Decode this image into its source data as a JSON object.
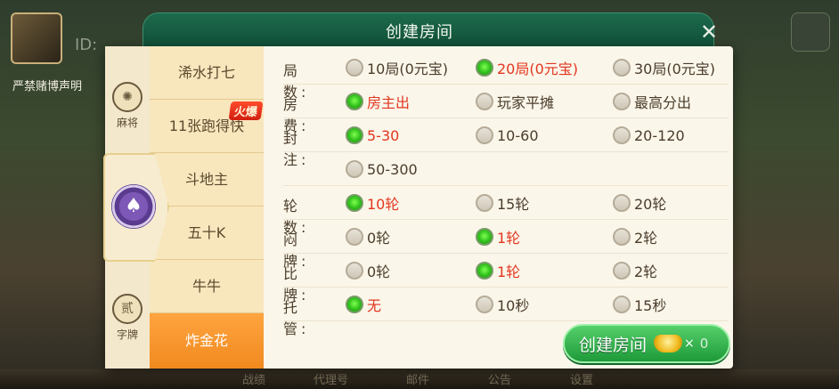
{
  "background": {
    "id_label": "ID:",
    "user_name": "严禁赌博声明",
    "bottom_nav": [
      "战绩",
      "代理号",
      "邮件",
      "公告",
      "设置"
    ]
  },
  "dialog": {
    "title": "创建房间",
    "close_glyph": "✕",
    "categories": [
      {
        "label": "麻将",
        "icon": "mahjong-icon",
        "glyph": "✺"
      },
      {
        "label": "字牌",
        "icon": "zipai-icon",
        "glyph": "贰"
      }
    ],
    "poker_icon": "poker-chip-icon",
    "games": [
      {
        "label": "浠水打七"
      },
      {
        "label": "11张跑得快",
        "badge": "火爆"
      },
      {
        "label": "斗地主"
      },
      {
        "label": "五十K"
      },
      {
        "label": "牛牛"
      },
      {
        "label": "炸金花",
        "active": true
      }
    ],
    "options": [
      {
        "label": "局 数:",
        "choices": [
          {
            "text": "10局(0元宝)",
            "on": false
          },
          {
            "text": "20局(0元宝)",
            "on": true
          },
          {
            "text": "30局(0元宝)",
            "on": false
          }
        ]
      },
      {
        "label": "房 费:",
        "choices": [
          {
            "text": "房主出",
            "on": true
          },
          {
            "text": "玩家平摊",
            "on": false
          },
          {
            "text": "最高分出",
            "on": false
          }
        ]
      },
      {
        "label": "封 注:",
        "choices": [
          {
            "text": "5-30",
            "on": true
          },
          {
            "text": "10-60",
            "on": false
          },
          {
            "text": "20-120",
            "on": false
          }
        ]
      },
      {
        "label": "",
        "choices": [
          {
            "text": "50-300",
            "on": false
          }
        ]
      },
      {
        "label": "轮 数:",
        "choices": [
          {
            "text": "10轮",
            "on": true
          },
          {
            "text": "15轮",
            "on": false
          },
          {
            "text": "20轮",
            "on": false
          }
        ]
      },
      {
        "label": "闷 牌:",
        "choices": [
          {
            "text": "0轮",
            "on": false
          },
          {
            "text": "1轮",
            "on": true
          },
          {
            "text": "2轮",
            "on": false
          }
        ]
      },
      {
        "label": "比 牌:",
        "choices": [
          {
            "text": "0轮",
            "on": false
          },
          {
            "text": "1轮",
            "on": true
          },
          {
            "text": "2轮",
            "on": false
          }
        ]
      },
      {
        "label": "托 管:",
        "choices": [
          {
            "text": "无",
            "on": true
          },
          {
            "text": "10秒",
            "on": false
          },
          {
            "text": "15秒",
            "on": false
          }
        ]
      }
    ],
    "create_button": {
      "label": "创建房间",
      "times": "×",
      "cost": "0",
      "icon": "gold-ingot-icon"
    }
  },
  "colors": {
    "accent_green": "#2fbf1b",
    "selected_text": "#e2361f",
    "active_tab": "#f08a1f",
    "title_bar": "#0f4d36"
  }
}
